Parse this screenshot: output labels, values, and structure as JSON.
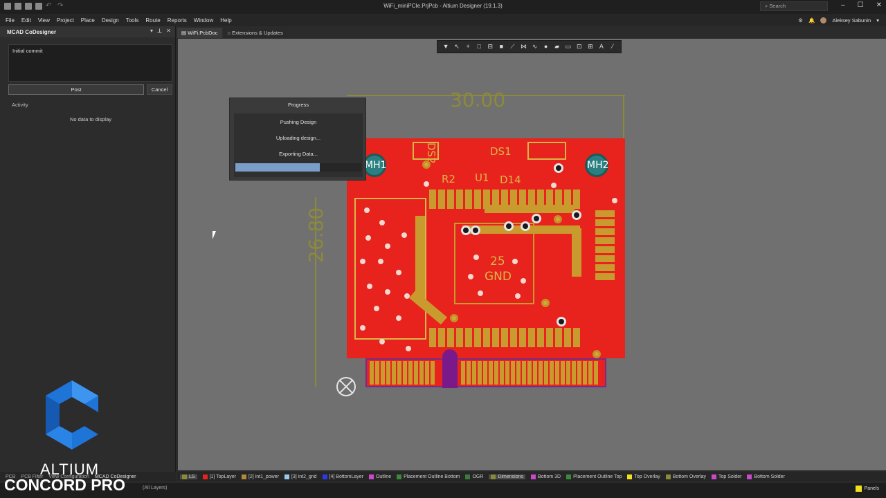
{
  "window": {
    "title": "WiFi_miniPCIe.PrjPcb - Altium Designer (19.1.3)",
    "search_placeholder": "Search",
    "user_name": "Aleksey Sabunin"
  },
  "menu": [
    "File",
    "Edit",
    "View",
    "Project",
    "Place",
    "Design",
    "Tools",
    "Route",
    "Reports",
    "Window",
    "Help"
  ],
  "panel": {
    "title": "MCAD CoDesigner",
    "commit_message": "Initial commit",
    "post_label": "Post",
    "cancel_label": "Cancel",
    "activity_label": "Activity",
    "activity_empty": "No data to display",
    "bottom_tabs": [
      "PCB",
      "PCB Filter",
      "View Configuration",
      "MCAD CoDesigner"
    ]
  },
  "doc_tabs": [
    {
      "label": "WiFi.PcbDoc",
      "active": true
    },
    {
      "label": "Extensions & Updates",
      "active": false
    }
  ],
  "pcb": {
    "dim_width": "30.00",
    "dim_height": "26.80",
    "labels": {
      "mh1": "MH1",
      "mh2": "MH2",
      "ds2": "DS2",
      "ds1": "DS1",
      "r2": "R2",
      "u1": "U1",
      "d14": "D14",
      "gnd_num": "25",
      "gnd": "GND"
    }
  },
  "progress": {
    "title": "Progress",
    "steps": [
      "Pushing Design",
      "Uploading design...",
      "Exporting Data..."
    ],
    "fraction": 0.67
  },
  "layers": [
    {
      "label": "LS",
      "color": "#8c8a3a",
      "active": true
    },
    {
      "label": "[1] TopLayer",
      "color": "#e8221c"
    },
    {
      "label": "[2] int1_power",
      "color": "#b08a3a"
    },
    {
      "label": "[3] int2_gnd",
      "color": "#9ac8e8"
    },
    {
      "label": "[4] BottomLayer",
      "color": "#2a3ae8"
    },
    {
      "label": "Outline",
      "color": "#c84ac8"
    },
    {
      "label": "Placement Outline Bottom",
      "color": "#3a8a3a"
    },
    {
      "label": "OGR",
      "color": "#3a7a3a"
    },
    {
      "label": "Dimensions",
      "color": "#8c8a3a",
      "active": true
    },
    {
      "label": "Bottom 3D",
      "color": "#c84ac8"
    },
    {
      "label": "Placement Outline Top",
      "color": "#3a8a3a"
    },
    {
      "label": "Top Overlay",
      "color": "#f0e020"
    },
    {
      "label": "Bottom Overlay",
      "color": "#8c8a3a"
    },
    {
      "label": "Top Solder",
      "color": "#c84ac8"
    },
    {
      "label": "Bottom Solder",
      "color": "#c84ac8"
    }
  ],
  "status": {
    "layers_text": "(All Layers)",
    "panels_label": "Panels"
  },
  "watermark": {
    "line1": "ALTIUM",
    "line2": "CONCORD PRO"
  }
}
